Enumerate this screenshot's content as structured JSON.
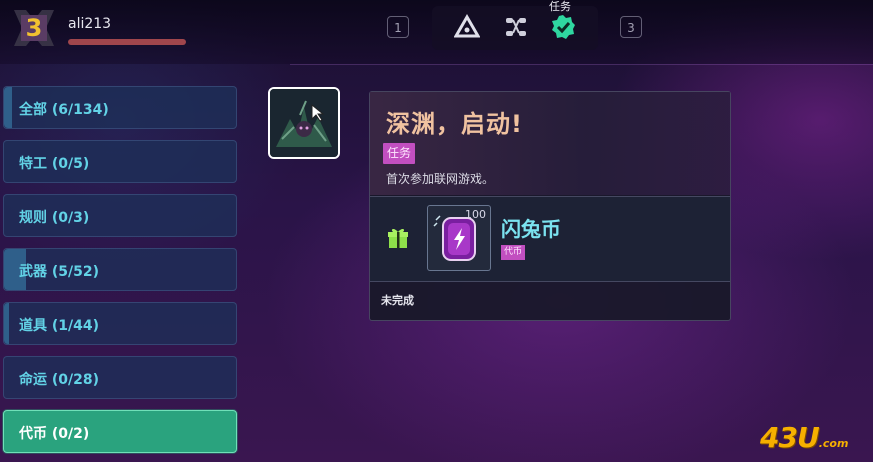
{
  "header": {
    "level": "3",
    "username": "ali213",
    "key_left": "1",
    "key_right": "3",
    "active_tab_label": "任务",
    "tabs": [
      {
        "icon": "triangle-eye-icon",
        "active": false
      },
      {
        "icon": "nodes-icon",
        "active": false
      },
      {
        "icon": "check-badge-icon",
        "active": true
      }
    ]
  },
  "categories": [
    {
      "label": "全部 (6/134)",
      "active": false
    },
    {
      "label": "特工 (0/5)",
      "active": false
    },
    {
      "label": "规则 (0/3)",
      "active": false
    },
    {
      "label": "武器 (5/52)",
      "active": false
    },
    {
      "label": "道具 (1/44)",
      "active": false
    },
    {
      "label": "命运 (0/28)",
      "active": false
    },
    {
      "label": "代币 (0/2)",
      "active": true
    }
  ],
  "detail": {
    "title": "深渊，启动!",
    "tag": "任务",
    "description": "首次参加联网游戏。",
    "reward": {
      "icon": "gift-icon",
      "count": "100",
      "name": "闪兔币",
      "tag": "代币"
    },
    "status": "未完成"
  },
  "watermark": {
    "main": "43U",
    "suffix": ".com"
  },
  "colors": {
    "accent_cyan": "#62d2e6",
    "active_green": "#2aa37e",
    "tag_magenta": "#c24fc0",
    "level_gold": "#f2c230"
  }
}
